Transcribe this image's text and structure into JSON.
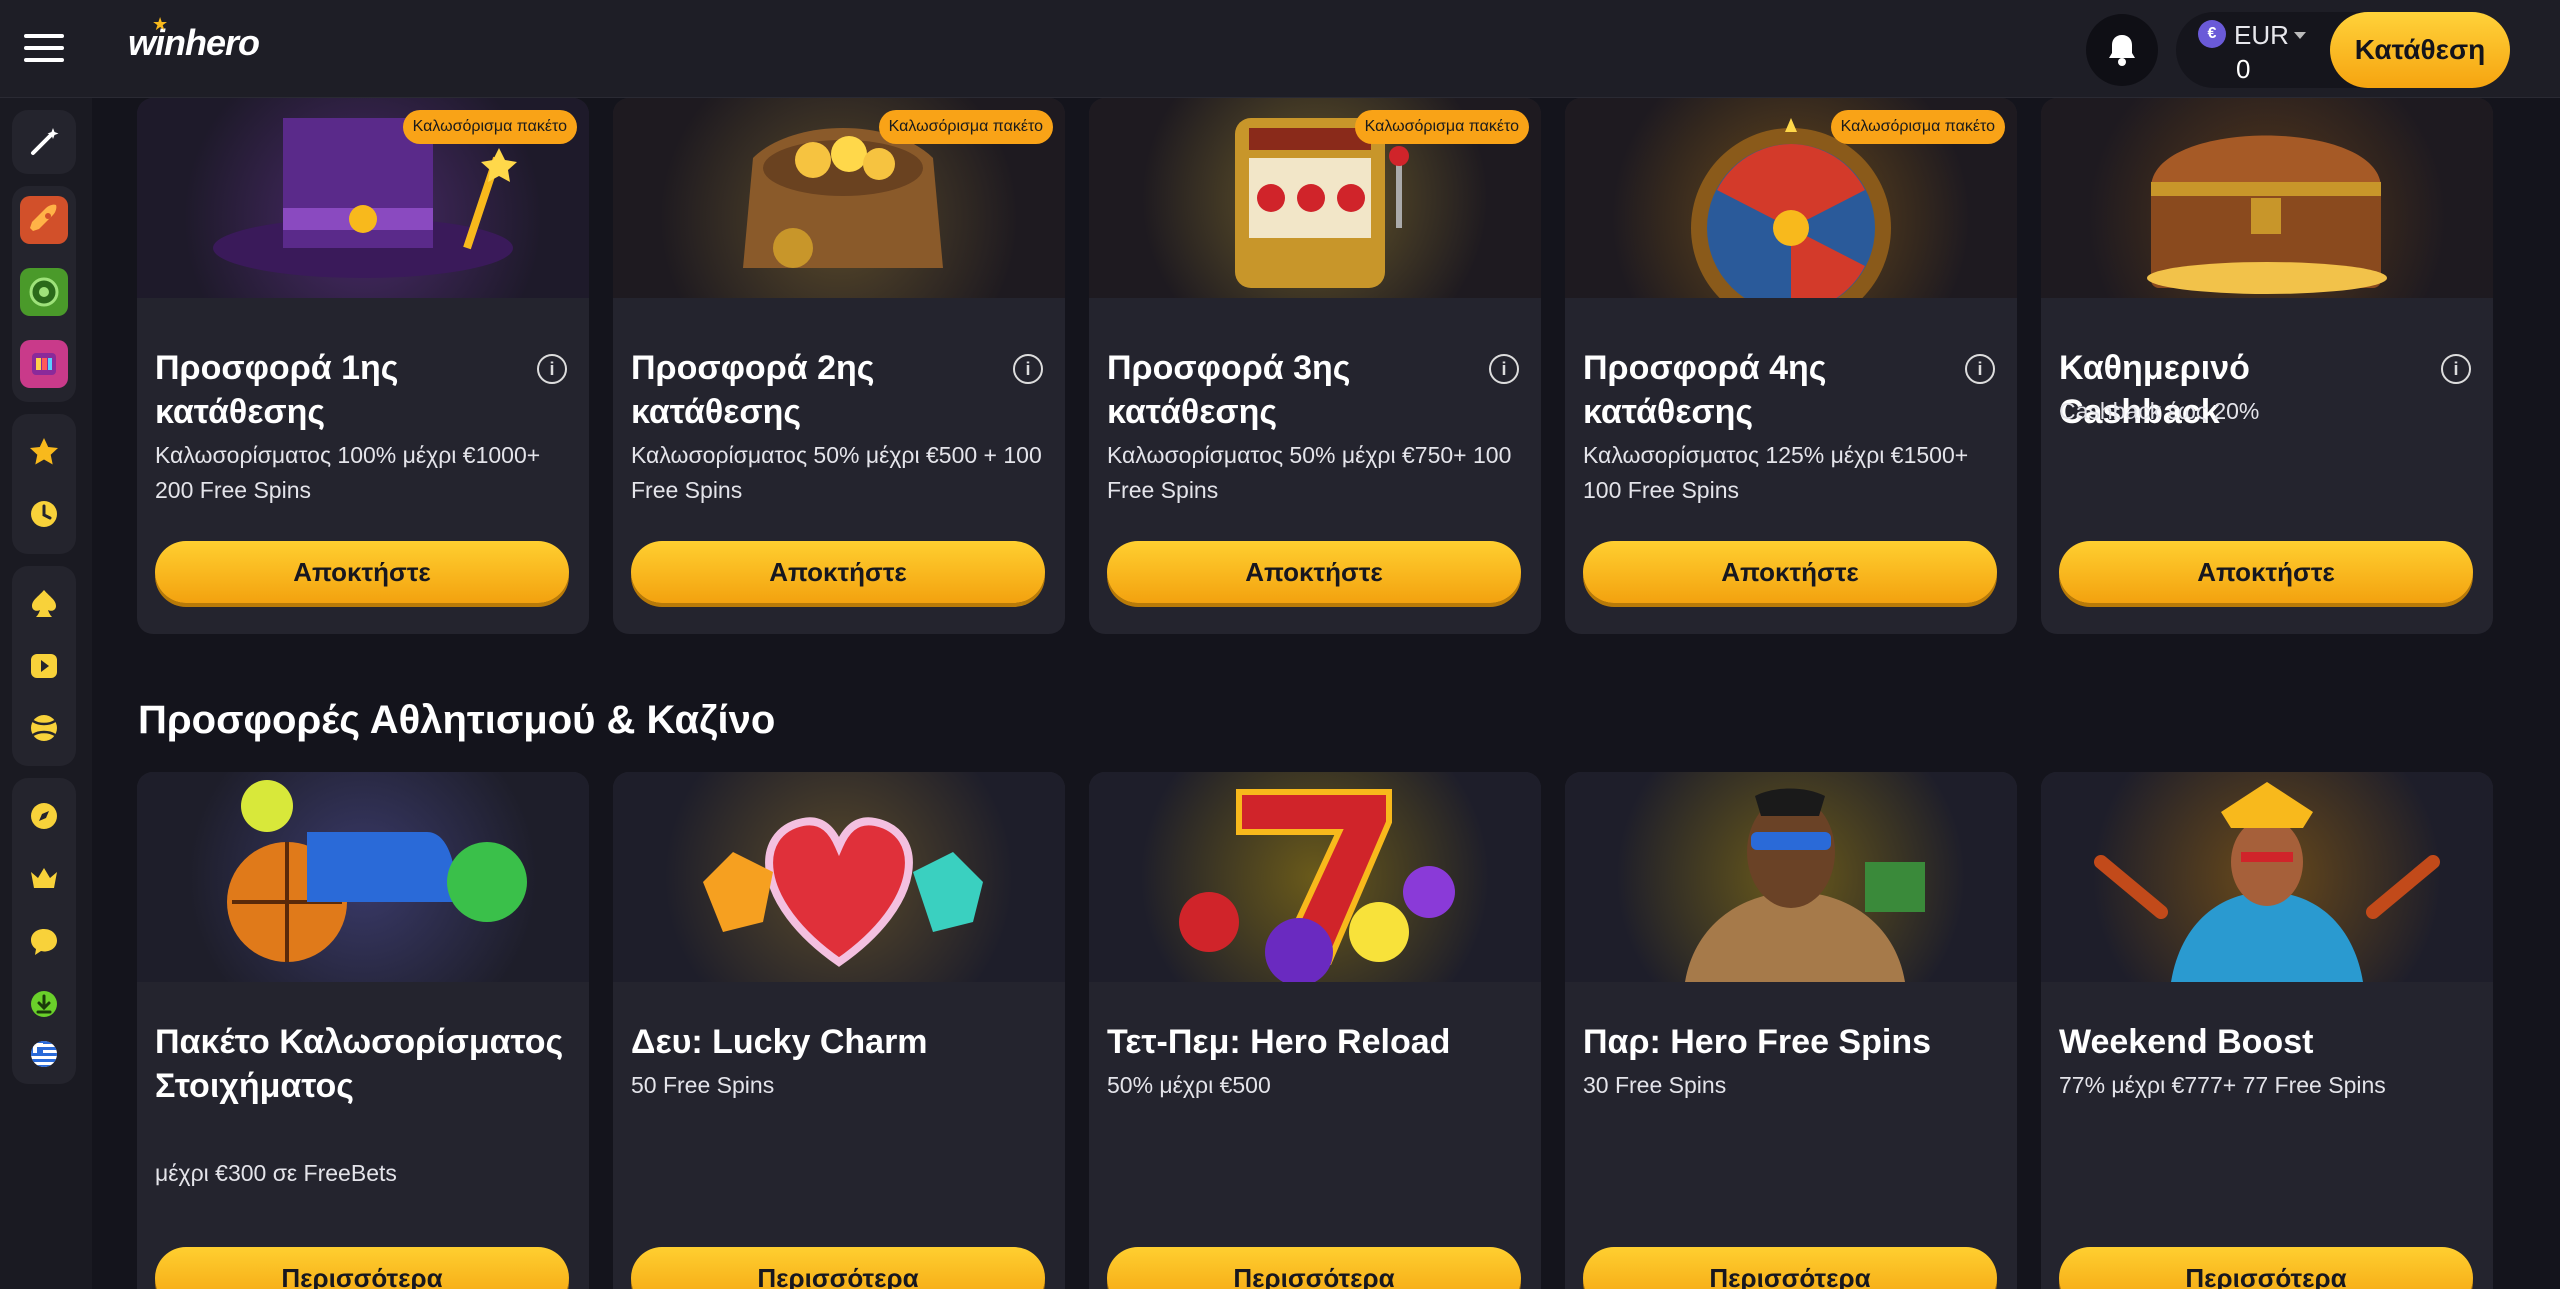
{
  "header": {
    "logo": "winhero",
    "currency": "EUR",
    "currency_symbol": "€",
    "balance": "0",
    "deposit_label": "Κατάθεση"
  },
  "sidebar": {
    "icons": [
      "magic-wand-icon",
      "rocket-game-icon",
      "roulette-game-icon",
      "slot-game-icon",
      "star-icon",
      "clock-icon",
      "spade-icon",
      "play-icon",
      "sport-ball-icon",
      "compass-icon",
      "crown-icon",
      "chat-icon",
      "download-icon",
      "greek-flag-icon"
    ]
  },
  "welcome": [
    {
      "badge": "Καλωσόρισμα πακέτο",
      "title": "Προσφορά 1ης κατάθεσης",
      "desc": "Καλωσορίσματος 100% μέχρι €1000+ 200 Free Spins",
      "button": "Αποκτήστε",
      "img": "top-hat-icon",
      "c1": "#6a2ca0",
      "c2": "#e3b34a"
    },
    {
      "badge": "Καλωσόρισμα πακέτο",
      "title": "Προσφορά 2ης κατάθεσης",
      "desc": "Καλωσορίσματος 50% μέχρι €500 + 100 Free Spins",
      "button": "Αποκτήστε",
      "img": "coin-bag-icon",
      "c1": "#8a5a2a",
      "c2": "#f6c340"
    },
    {
      "badge": "Καλωσόρισμα πακέτο",
      "title": "Προσφορά 3ης κατάθεσης",
      "desc": "Καλωσορίσματος 50% μέχρι €750+ 100 Free Spins",
      "button": "Αποκτήστε",
      "img": "slot-machine-icon",
      "c1": "#c9302c",
      "c2": "#f2c94c"
    },
    {
      "badge": "Καλωσόρισμα πακέτο",
      "title": "Προσφορά 4ης κατάθεσης",
      "desc": "Καλωσορίσματος 125% μέχρι €1500+ 100 Free Spins",
      "button": "Αποκτήστε",
      "img": "fortune-wheel-icon",
      "c1": "#2a5a9a",
      "c2": "#d33a2a"
    },
    {
      "badge": "",
      "title": "Καθημερινό Cashback",
      "desc": "Cashback έως 20%",
      "button": "Αποκτήστε",
      "img": "treasure-chest-icon",
      "c1": "#8a4a1e",
      "c2": "#f2c24a"
    }
  ],
  "section_title": "Προσφορές Αθλητισμού & Καζίνο",
  "promos": [
    {
      "title": "Πακέτο Καλωσορίσματος Στοιχήματος",
      "desc": "μέχρι €300 σε FreeBets",
      "button": "Περισσότερα",
      "img": "sports-balls-icon",
      "c1": "#2a6ad8",
      "c2": "#f08a1c"
    },
    {
      "title": "Δευ: Lucky Charm",
      "desc": "50 Free Spins",
      "button": "Περισσότερα",
      "img": "heart-gem-icon",
      "c1": "#e0303a",
      "c2": "#3ad0c0"
    },
    {
      "title": "Τετ-Πεμ: Hero Reload",
      "desc": "50% μέχρι €500",
      "button": "Περισσότερα",
      "img": "lucky-seven-icon",
      "c1": "#d0242a",
      "c2": "#8a3ad8"
    },
    {
      "title": "Παρ: Hero Free Spins",
      "desc": "30 Free Spins",
      "button": "Περισσότερα",
      "img": "hero-character-icon",
      "c1": "#7a4a2a",
      "c2": "#3a8a3a"
    },
    {
      "title": "Weekend Boost",
      "desc": "77% μέχρι €777+ 77 Free Spins",
      "button": "Περισσότερα",
      "img": "aztec-warrior-icon",
      "c1": "#c24a1a",
      "c2": "#2a9ad0"
    }
  ]
}
